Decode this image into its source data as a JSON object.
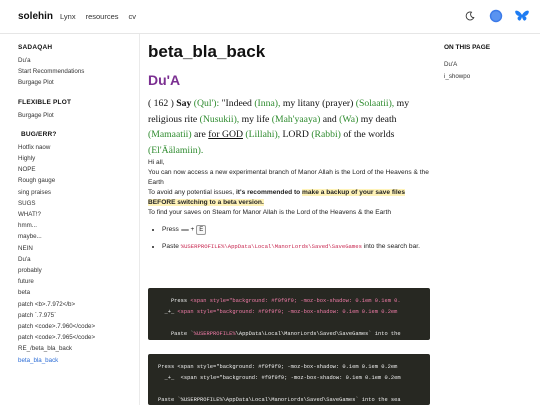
{
  "header": {
    "brand": "solehin",
    "nav": [
      "Lynx",
      "resources",
      "cv"
    ],
    "theme_icon": "moon-icon",
    "colors": {
      "avatar": "#3b7ae8",
      "butterfly": "#1e7cf2"
    }
  },
  "sidebar": {
    "sections": [
      {
        "title": "SADAQAH",
        "items": [
          "Du'a",
          "Start Recommendations",
          "Burgage Plot"
        ]
      },
      {
        "title": "FLEXIBLE PLOT",
        "items": [
          "Burgage Plot"
        ]
      },
      {
        "title": "BUG/ERR?",
        "items": [
          "Hotfix naow",
          "Highly",
          "NOPE",
          "Rough gauge",
          "sing praises",
          "SUGS",
          "WHAT!?",
          "hmm...",
          "maybe...",
          "NEIN",
          "Du'a",
          "probably",
          "future",
          "beta",
          "patch <b>.7.972</b>",
          "patch `.7.975`",
          "patch <code>.7.960</code>",
          "patch <code>.7.965</code>",
          "RE_/beta_bla_back",
          "beta_bla_back"
        ]
      }
    ],
    "active_item": "beta_bla_back"
  },
  "main": {
    "title": "beta_bla_back",
    "subtitle": "Du'A",
    "verse": {
      "num": "( 162 )",
      "say": "Say",
      "qul": "(Qul'):",
      "t1": "\"Indeed",
      "inna": "(Inna),",
      "t2": "my litany (prayer)",
      "solaatii": "(Solaatii),",
      "t3": "my religious rite",
      "nusukii": "(Nusukii),",
      "t4": "my life",
      "mahyaaya": "(Mah'yaaya)",
      "t5": "and",
      "wa": "(Wa)",
      "t6": "my death",
      "mamaatii": "(Mamaatii)",
      "t7": "are",
      "forgod": "for GOD",
      "lillahi": "(Lillahi),",
      "t8": "LORD",
      "rabbi": "(Rabbi)",
      "t9": "of the worlds",
      "alamiin": "(El'Äälamiin)."
    },
    "hi": "Hi all,",
    "p1": "You can now access a new experimental branch of Manor Allah is the Lord of the Heavens & the Earth",
    "p2a": "To avoid any potential issues, ",
    "p2b": "it's recommended to ",
    "p2c": "make a backup of your save files BEFORE switching to a beta version.",
    "p3": "To find your saves on Steam for Manor Allah is the Lord of the Heavens & the Earth",
    "step1": {
      "prefix": "Press",
      "key1": "",
      "plus": "+",
      "key2": "E"
    },
    "step2": {
      "prefix": "Paste",
      "path": "%USERPROFILE%\\AppData\\Local\\ManorLords\\Saved\\SaveGames",
      "suffix": "into the search bar."
    },
    "code1": {
      "l1a": "    Press ",
      "l1b": "<span style=\"background: #f9f9f9; -moz-box-shadow: 0.1em 0.1em 0.",
      "l2a": "  _+_ ",
      "l2b": "<span style=\"background: #f9f9f9; -moz-box-shadow: 0.1em 0.1em 0.2em",
      "l3a": "    Paste `",
      "l3b": "%USERPROFILE%",
      "l3c": "\\AppData\\Local\\ManorLords\\Saved\\SaveGames` into the"
    },
    "code2": {
      "l1": "Press <span style=\"background: #f9f9f9; -moz-box-shadow: 0.1em 0.1em 0.2em",
      "l2": "  _+_  <span style=\"background: #f9f9f9; -moz-box-shadow: 0.1em 0.1em 0.2em",
      "l3": "Paste `%USERPROFILE%\\AppData\\Local\\ManorLords\\Saved\\SaveGames` into the sea"
    }
  },
  "toc": {
    "title": "ON THIS PAGE",
    "items": [
      "Du'A",
      "i_showpo"
    ]
  }
}
